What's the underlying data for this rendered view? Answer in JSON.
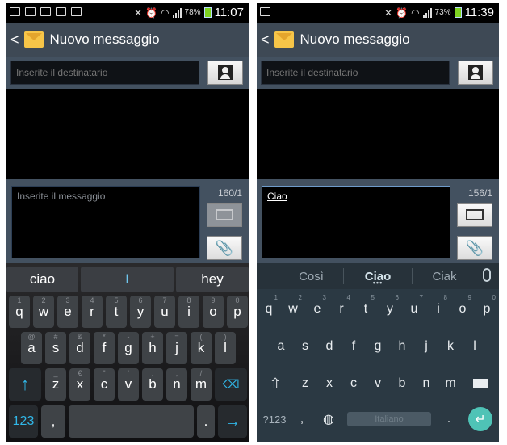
{
  "left": {
    "status": {
      "battery": "78%",
      "time": "11:07"
    },
    "header": {
      "back": "<",
      "title": "Nuovo messaggio"
    },
    "recipient_placeholder": "Inserite il destinatario",
    "message_placeholder": "Inserite il messaggio",
    "counter": "160/1",
    "suggestions": [
      "ciao",
      "I",
      "hey"
    ],
    "rows": [
      [
        {
          "k": "q",
          "s": "1"
        },
        {
          "k": "w",
          "s": "2"
        },
        {
          "k": "e",
          "s": "3"
        },
        {
          "k": "r",
          "s": "4"
        },
        {
          "k": "t",
          "s": "5"
        },
        {
          "k": "y",
          "s": "6"
        },
        {
          "k": "u",
          "s": "7"
        },
        {
          "k": "i",
          "s": "8"
        },
        {
          "k": "o",
          "s": "9"
        },
        {
          "k": "p",
          "s": "0"
        }
      ],
      [
        {
          "k": "a",
          "s": "@"
        },
        {
          "k": "s",
          "s": "#"
        },
        {
          "k": "d",
          "s": "&"
        },
        {
          "k": "f",
          "s": "*"
        },
        {
          "k": "g",
          "s": "-"
        },
        {
          "k": "h",
          "s": "+"
        },
        {
          "k": "j",
          "s": "="
        },
        {
          "k": "k",
          "s": "("
        },
        {
          "k": "l",
          "s": ")"
        }
      ],
      [
        {
          "k": "z",
          "s": "_"
        },
        {
          "k": "x",
          "s": "€"
        },
        {
          "k": "c",
          "s": "\""
        },
        {
          "k": "v",
          "s": "'"
        },
        {
          "k": "b",
          "s": ":"
        },
        {
          "k": "n",
          "s": ";"
        },
        {
          "k": "m",
          "s": "/"
        }
      ]
    ],
    "bottom": {
      "num": "123",
      "comma": ",",
      "period": "."
    }
  },
  "right": {
    "status": {
      "battery": "73%",
      "time": "11:39"
    },
    "header": {
      "back": "<",
      "title": "Nuovo messaggio"
    },
    "recipient_placeholder": "Inserite il destinatario",
    "message_value": "Ciao",
    "counter": "156/1",
    "suggestions": [
      "Così",
      "Ciao",
      "Ciak"
    ],
    "rows": [
      [
        {
          "k": "q",
          "s": "1"
        },
        {
          "k": "w",
          "s": "2"
        },
        {
          "k": "e",
          "s": "3"
        },
        {
          "k": "r",
          "s": "4"
        },
        {
          "k": "t",
          "s": "5"
        },
        {
          "k": "y",
          "s": "6"
        },
        {
          "k": "u",
          "s": "7"
        },
        {
          "k": "i",
          "s": "8"
        },
        {
          "k": "o",
          "s": "9"
        },
        {
          "k": "p",
          "s": "0"
        }
      ],
      [
        {
          "k": "a"
        },
        {
          "k": "s"
        },
        {
          "k": "d"
        },
        {
          "k": "f"
        },
        {
          "k": "g"
        },
        {
          "k": "h"
        },
        {
          "k": "j"
        },
        {
          "k": "k"
        },
        {
          "k": "l"
        }
      ],
      [
        {
          "k": "z"
        },
        {
          "k": "x"
        },
        {
          "k": "c"
        },
        {
          "k": "v"
        },
        {
          "k": "b"
        },
        {
          "k": "n"
        },
        {
          "k": "m"
        }
      ]
    ],
    "bottom": {
      "num": "?123",
      "comma": ",",
      "space": "Italiano",
      "period": "."
    }
  }
}
